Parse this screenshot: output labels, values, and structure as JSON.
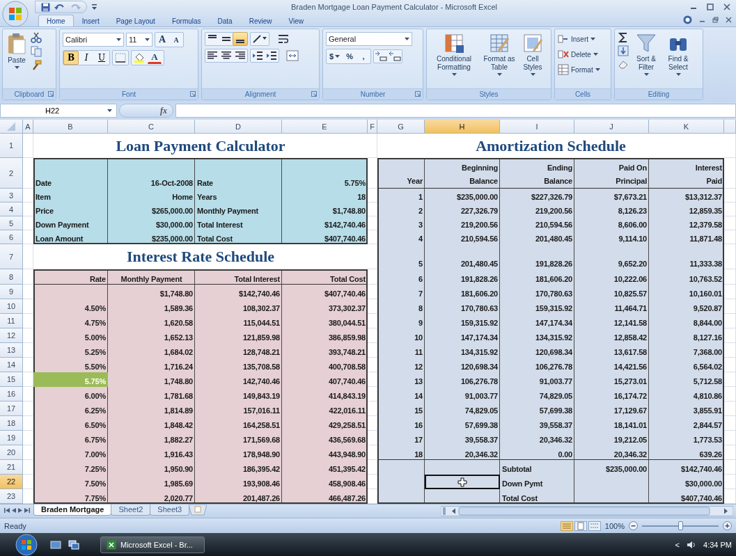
{
  "window": {
    "title": "Braden Mortgage Loan Payment Calculator - Microsoft Excel"
  },
  "ribbon": {
    "tabs": [
      {
        "label": "Home",
        "selected": true
      },
      {
        "label": "Insert",
        "selected": false
      },
      {
        "label": "Page Layout",
        "selected": false
      },
      {
        "label": "Formulas",
        "selected": false
      },
      {
        "label": "Data",
        "selected": false
      },
      {
        "label": "Review",
        "selected": false
      },
      {
        "label": "View",
        "selected": false
      }
    ],
    "clipboard": {
      "label": "Clipboard",
      "paste": "Paste"
    },
    "font": {
      "label": "Font",
      "name": "Calibri",
      "size": "11",
      "grow": "A",
      "shrink": "A",
      "styles": [
        {
          "label": "B",
          "selected": true
        },
        {
          "label": "I",
          "selected": false
        },
        {
          "label": "U",
          "selected": false
        }
      ],
      "color_button": "A"
    },
    "alignment": {
      "label": "Alignment",
      "vertical": [
        {
          "selected": false
        },
        {
          "selected": false
        },
        {
          "selected": true
        }
      ]
    },
    "number": {
      "label": "Number",
      "format": "General",
      "buttons": [
        "$",
        "%",
        ","
      ]
    },
    "styles": {
      "label": "Styles",
      "buttons": [
        "Conditional Formatting",
        "Format as Table",
        "Cell Styles"
      ]
    },
    "cells": {
      "label": "Cells",
      "buttons": [
        "Insert",
        "Delete",
        "Format"
      ]
    },
    "editing": {
      "label": "Editing",
      "buttons": [
        "Sort & Filter",
        "Find & Select"
      ]
    }
  },
  "formula_bar": {
    "name_box": "H22",
    "function_label": "fx"
  },
  "sheet": {
    "column_headers": [
      {
        "label": "A",
        "selected": false
      },
      {
        "label": "B",
        "selected": false
      },
      {
        "label": "C",
        "selected": false
      },
      {
        "label": "D",
        "selected": false
      },
      {
        "label": "E",
        "selected": false
      },
      {
        "label": "F",
        "selected": false
      },
      {
        "label": "G",
        "selected": false
      },
      {
        "label": "H",
        "selected": true
      },
      {
        "label": "I",
        "selected": false
      },
      {
        "label": "J",
        "selected": false
      },
      {
        "label": "K",
        "selected": false
      }
    ],
    "row_headers": [
      {
        "label": "1",
        "selected": false
      },
      {
        "label": "2",
        "selected": false
      },
      {
        "label": "3",
        "selected": false
      },
      {
        "label": "4",
        "selected": false
      },
      {
        "label": "5",
        "selected": false
      },
      {
        "label": "6",
        "selected": false
      },
      {
        "label": "7",
        "selected": false
      },
      {
        "label": "8",
        "selected": false
      },
      {
        "label": "9",
        "selected": false
      },
      {
        "label": "10",
        "selected": false
      },
      {
        "label": "11",
        "selected": false
      },
      {
        "label": "12",
        "selected": false
      },
      {
        "label": "13",
        "selected": false
      },
      {
        "label": "14",
        "selected": false
      },
      {
        "label": "15",
        "selected": false
      },
      {
        "label": "16",
        "selected": false
      },
      {
        "label": "17",
        "selected": false
      },
      {
        "label": "18",
        "selected": false
      },
      {
        "label": "19",
        "selected": false
      },
      {
        "label": "20",
        "selected": false
      },
      {
        "label": "21",
        "selected": false
      },
      {
        "label": "22",
        "selected": true
      },
      {
        "label": "23",
        "selected": false
      }
    ],
    "loan_calculator": {
      "title": "Loan Payment Calculator",
      "rows": [
        [
          "Date",
          "16-Oct-2008",
          "Rate",
          "5.75%"
        ],
        [
          "Item",
          "Home",
          "Years",
          "18"
        ],
        [
          "Price",
          "$265,000.00",
          "Monthly Payment",
          "$1,748.80"
        ],
        [
          "Down Payment",
          "$30,000.00",
          "Total Interest",
          "$142,740.46"
        ],
        [
          "Loan Amount",
          "$235,000.00",
          "Total Cost",
          "$407,740.46"
        ]
      ]
    },
    "interest_rate_schedule": {
      "title": "Interest Rate Schedule",
      "columns": [
        "Rate",
        "Monthly Payment",
        "Total Interest",
        "Total Cost"
      ],
      "rows": [
        {
          "values": [
            "$1,748.80",
            "$142,740.46",
            "$407,740.46"
          ],
          "highlighted": false
        },
        {
          "rate": "4.50%",
          "values": [
            "1,589.36",
            "108,302.37",
            "373,302.37"
          ],
          "highlighted": false
        },
        {
          "rate": "4.75%",
          "values": [
            "1,620.58",
            "115,044.51",
            "380,044.51"
          ],
          "highlighted": false
        },
        {
          "rate": "5.00%",
          "values": [
            "1,652.13",
            "121,859.98",
            "386,859.98"
          ],
          "highlighted": false
        },
        {
          "rate": "5.25%",
          "values": [
            "1,684.02",
            "128,748.21",
            "393,748.21"
          ],
          "highlighted": false
        },
        {
          "rate": "5.50%",
          "values": [
            "1,716.24",
            "135,708.58",
            "400,708.58"
          ],
          "highlighted": false
        },
        {
          "rate": "5.75%",
          "values": [
            "1,748.80",
            "142,740.46",
            "407,740.46"
          ],
          "highlighted": true
        },
        {
          "rate": "6.00%",
          "values": [
            "1,781.68",
            "149,843.19",
            "414,843.19"
          ],
          "highlighted": false
        },
        {
          "rate": "6.25%",
          "values": [
            "1,814.89",
            "157,016.11",
            "422,016.11"
          ],
          "highlighted": false
        },
        {
          "rate": "6.50%",
          "values": [
            "1,848.42",
            "164,258.51",
            "429,258.51"
          ],
          "highlighted": false
        },
        {
          "rate": "6.75%",
          "values": [
            "1,882.27",
            "171,569.68",
            "436,569.68"
          ],
          "highlighted": false
        },
        {
          "rate": "7.00%",
          "values": [
            "1,916.43",
            "178,948.90",
            "443,948.90"
          ],
          "highlighted": false
        },
        {
          "rate": "7.25%",
          "values": [
            "1,950.90",
            "186,395.42",
            "451,395.42"
          ],
          "highlighted": false
        },
        {
          "rate": "7.50%",
          "values": [
            "1,985.69",
            "193,908.46",
            "458,908.46"
          ],
          "highlighted": false
        },
        {
          "rate": "7.75%",
          "values": [
            "2,020.77",
            "201,487.26",
            "466,487.26"
          ],
          "highlighted": false
        }
      ]
    },
    "amortization_schedule": {
      "title": "Amortization Schedule",
      "columns": [
        {
          "lines": [
            "Year"
          ]
        },
        {
          "lines": [
            "Beginning",
            "Balance"
          ]
        },
        {
          "lines": [
            "Ending",
            "Balance"
          ]
        },
        {
          "lines": [
            "Paid On",
            "Principal"
          ]
        },
        {
          "lines": [
            "Interest",
            "Paid"
          ]
        }
      ],
      "rows": [
        [
          "1",
          "$235,000.00",
          "$227,326.79",
          "$7,673.21",
          "$13,312.37"
        ],
        [
          "2",
          "227,326.79",
          "219,200.56",
          "8,126.23",
          "12,859.35"
        ],
        [
          "3",
          "219,200.56",
          "210,594.56",
          "8,606.00",
          "12,379.58"
        ],
        [
          "4",
          "210,594.56",
          "201,480.45",
          "9,114.10",
          "11,871.48"
        ],
        [
          "5",
          "201,480.45",
          "191,828.26",
          "9,652.20",
          "11,333.38"
        ],
        [
          "6",
          "191,828.26",
          "181,606.20",
          "10,222.06",
          "10,763.52"
        ],
        [
          "7",
          "181,606.20",
          "170,780.63",
          "10,825.57",
          "10,160.01"
        ],
        [
          "8",
          "170,780.63",
          "159,315.92",
          "11,464.71",
          "9,520.87"
        ],
        [
          "9",
          "159,315.92",
          "147,174.34",
          "12,141.58",
          "8,844.00"
        ],
        [
          "10",
          "147,174.34",
          "134,315.92",
          "12,858.42",
          "8,127.16"
        ],
        [
          "11",
          "134,315.92",
          "120,698.34",
          "13,617.58",
          "7,368.00"
        ],
        [
          "12",
          "120,698.34",
          "106,276.78",
          "14,421.56",
          "6,564.02"
        ],
        [
          "13",
          "106,276.78",
          "91,003.77",
          "15,273.01",
          "5,712.58"
        ],
        [
          "14",
          "91,003.77",
          "74,829.05",
          "16,174.72",
          "4,810.86"
        ],
        [
          "15",
          "74,829.05",
          "57,699.38",
          "17,129.67",
          "3,855.91"
        ],
        [
          "16",
          "57,699.38",
          "39,558.37",
          "18,141.01",
          "2,844.57"
        ],
        [
          "17",
          "39,558.37",
          "20,346.32",
          "19,212.05",
          "1,773.53"
        ],
        [
          "18",
          "20,346.32",
          "0.00",
          "20,346.32",
          "639.26"
        ]
      ],
      "totals": [
        {
          "label": "Subtotal",
          "paid_on_principal": "$235,000.00",
          "interest_paid": "$142,740.46"
        },
        {
          "label": "Down Pymt",
          "interest_paid": "$30,000.00"
        },
        {
          "label": "Total Cost",
          "interest_paid": "$407,740.46"
        }
      ]
    }
  },
  "sheet_tabs": [
    {
      "label": "Braden Mortgage",
      "selected": true
    },
    {
      "label": "Sheet2",
      "selected": false
    },
    {
      "label": "Sheet3",
      "selected": false
    }
  ],
  "status_bar": {
    "status": "Ready",
    "zoom": {
      "label": "100%",
      "level": 0.5
    }
  },
  "taskbar": {
    "task": "Microsoft Excel - Br...",
    "tray_arrow": "<",
    "time": "4:34 PM"
  }
}
